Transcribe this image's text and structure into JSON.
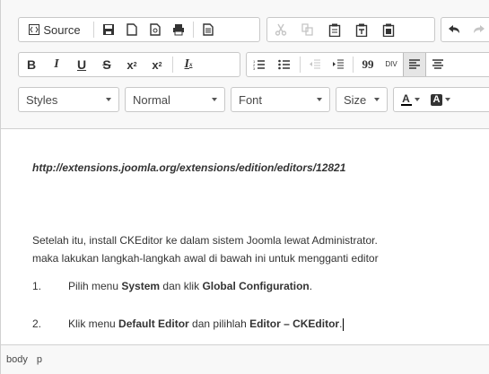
{
  "toolbar": {
    "source_label": "Source",
    "bold_label": "B",
    "italic_label": "I",
    "underline_label": "U",
    "strike_label": "S",
    "subscript_label": "x",
    "subscript_sub": "2",
    "superscript_label": "x",
    "superscript_sup": "2",
    "removeformat_label": "I",
    "removeformat_sub": "x",
    "blockquote_label": "99",
    "div_label": "DIV",
    "styles_label": "Styles",
    "format_label": "Normal",
    "font_label": "Font",
    "size_label": "Size",
    "textcolor_label": "A",
    "bgcolor_label": "A"
  },
  "content": {
    "link": "http://extensions.joomla.org/extensions/edition/editors/12821",
    "para1_line1": "Setelah itu, install CKEditor ke dalam sistem Joomla lewat Administrator.",
    "para1_line2": "maka lakukan langkah-langkah awal di bawah ini untuk mengganti editor",
    "list": [
      {
        "num": "1.",
        "pre": "Pilih menu ",
        "bold1": "System",
        "mid": " dan klik ",
        "bold2": "Global Configuration",
        "post": "."
      },
      {
        "num": "2.",
        "pre": "Klik menu ",
        "bold1": "Default Editor",
        "mid": " dan pilihlah ",
        "bold2": "Editor – CKEditor",
        "post": "."
      }
    ]
  },
  "statusbar": {
    "path": [
      "body",
      "p"
    ]
  },
  "colors": {
    "accent_textcolor": "#000000",
    "toolbar_bg": "#f8f8f8",
    "border": "#d1d1d1"
  },
  "icons": [
    "source-icon",
    "save-icon",
    "newpage-icon",
    "preview-icon",
    "print-icon",
    "templates-icon",
    "cut-icon",
    "copy-icon",
    "paste-icon",
    "paste-text-icon",
    "paste-word-icon",
    "undo-icon",
    "redo-icon",
    "numbered-list-icon",
    "bulleted-list-icon",
    "outdent-icon",
    "indent-icon",
    "blockquote-icon",
    "div-icon",
    "align-left-icon",
    "align-center-icon"
  ]
}
